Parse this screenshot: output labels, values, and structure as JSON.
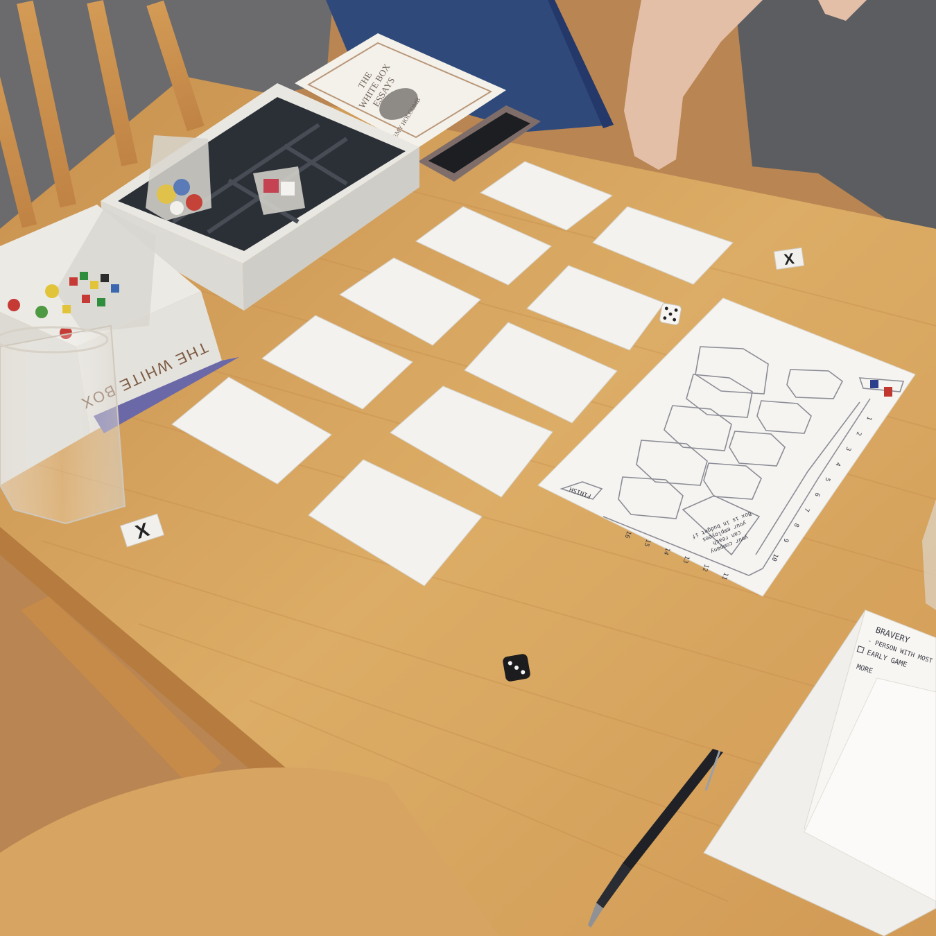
{
  "book": {
    "title_line1": "THE",
    "title_line2": "WHITE BOX",
    "title_line3": "ESSAYS",
    "by": "by",
    "author": "JEREMY HOLCOMB"
  },
  "box": {
    "side_label": "THE WHITE BOX"
  },
  "tokens": {
    "symbol": "X"
  },
  "board": {
    "footer_label": "FINISH",
    "note_line1": "Box is in budget if",
    "note_line2": "your employees",
    "note_line3": "can reach",
    "note_line4": "your company",
    "track_numbers": [
      "1",
      "2",
      "3",
      "4",
      "5",
      "6",
      "7",
      "8",
      "9",
      "10",
      "11",
      "12",
      "13",
      "14",
      "15",
      "16"
    ]
  },
  "notepad": {
    "heading": "BRAVERY",
    "line1": "- PERSON WITH MOST",
    "line2": "EARLY GAME",
    "line3": "MORE"
  },
  "dice": {
    "white_face": 5,
    "black_face": 3
  },
  "colors": {
    "table": "#d9a962",
    "paper": "#f3f2ef",
    "box_tray": "#2b2f36",
    "carpet": "#2f4a7a"
  }
}
